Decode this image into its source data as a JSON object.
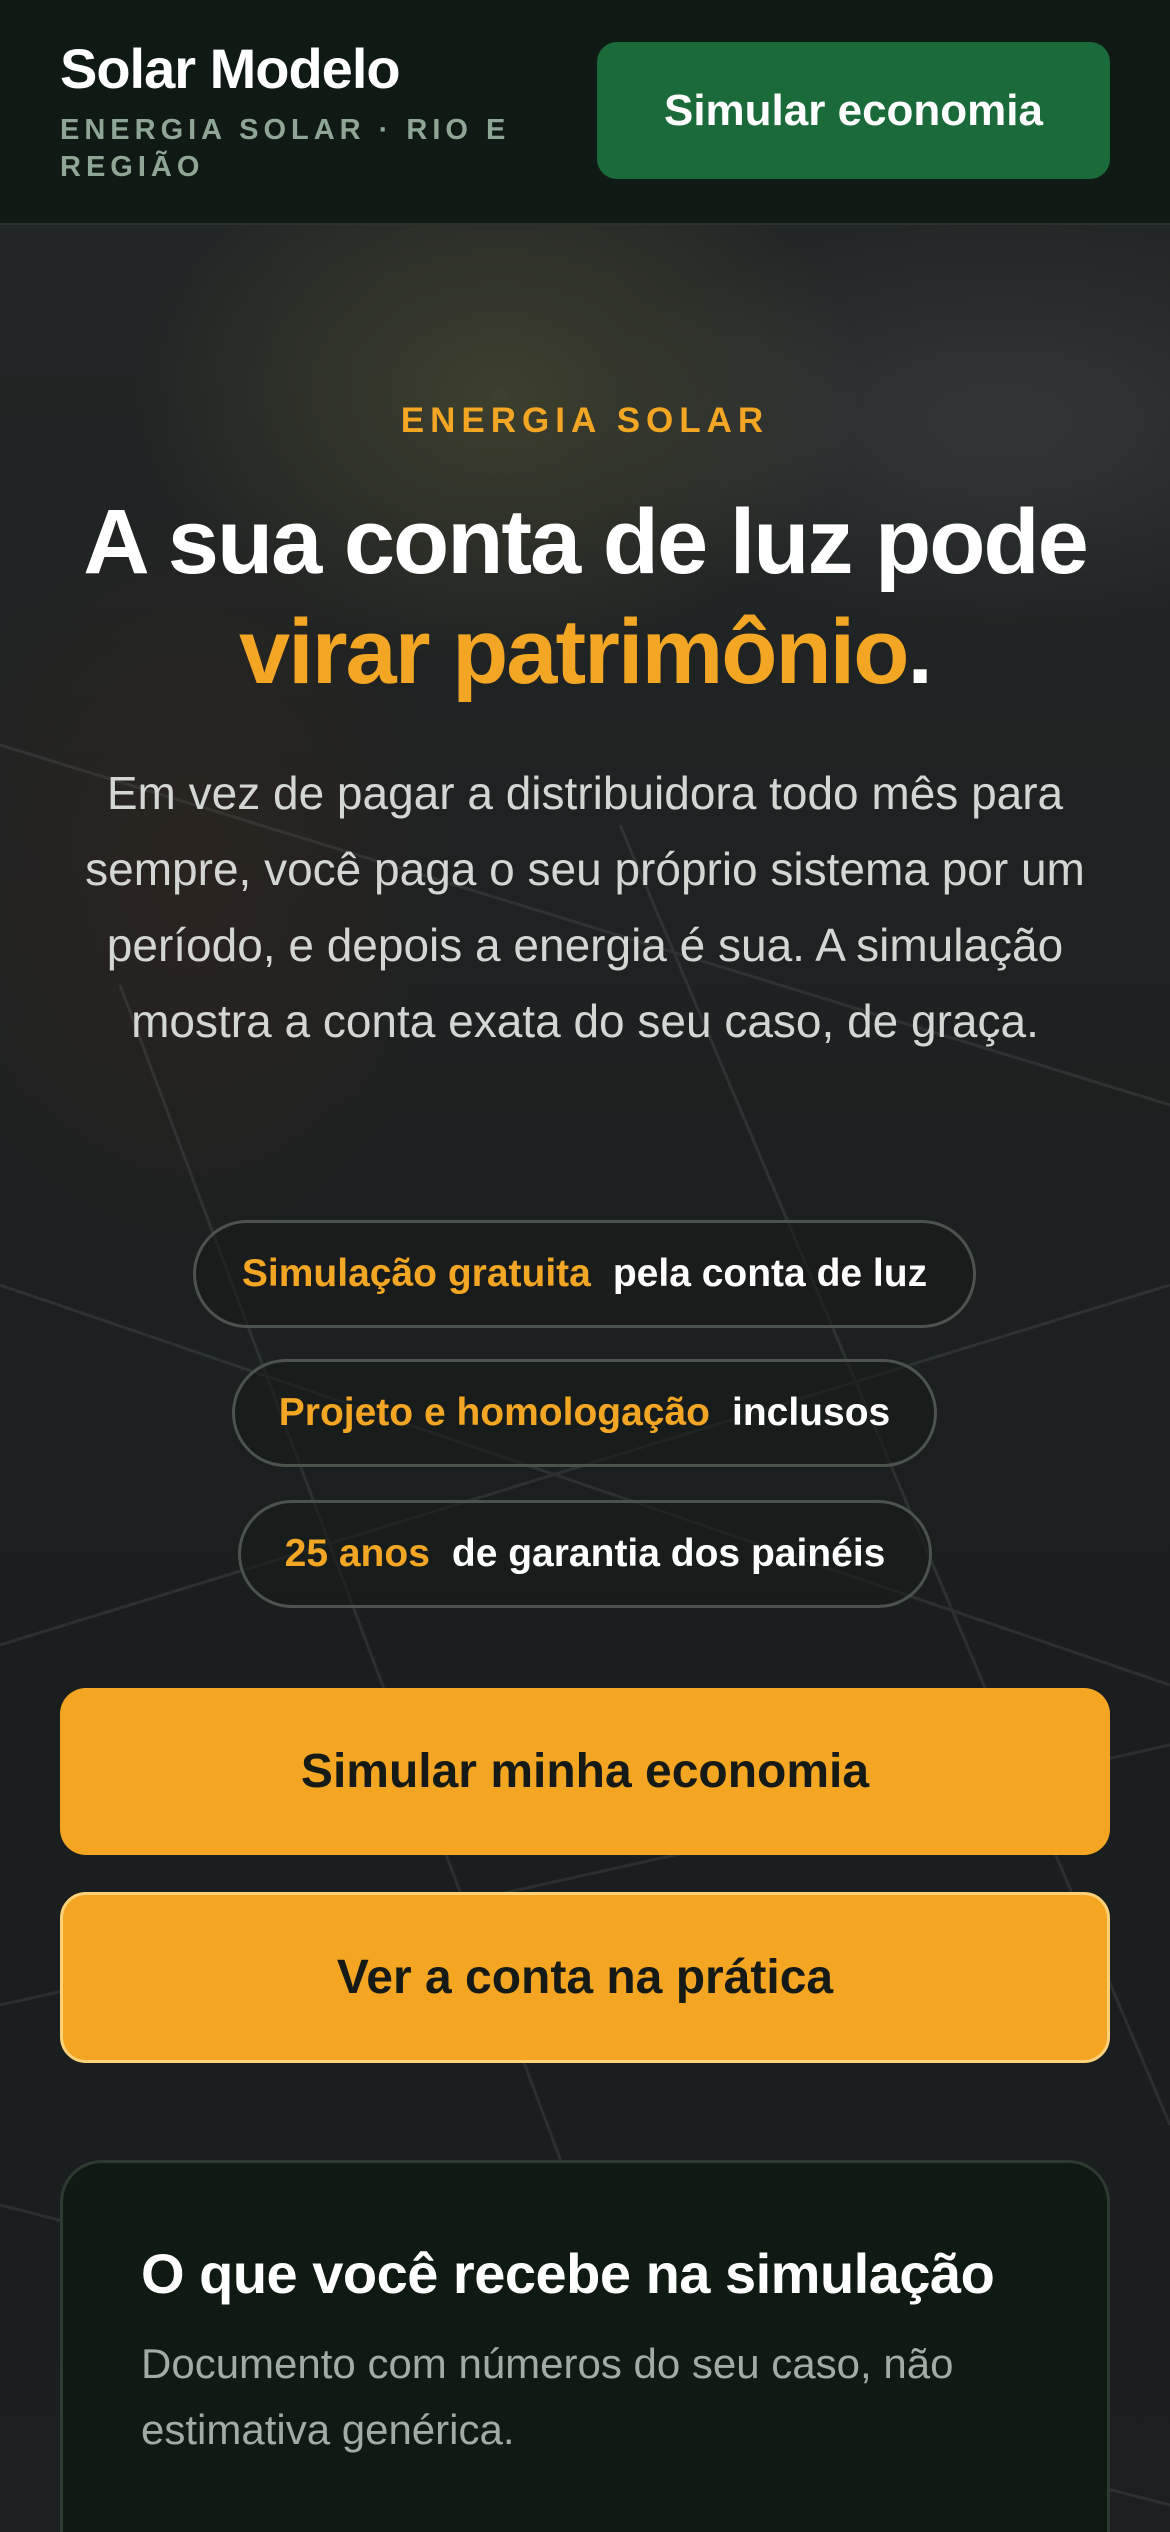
{
  "header": {
    "brand_name": "Solar Modelo",
    "brand_tagline": "ENERGIA SOLAR · RIO E REGIÃO",
    "cta_label": "Simular economia"
  },
  "hero": {
    "eyebrow": "ENERGIA SOLAR",
    "headline_part1": "A sua conta de luz pode",
    "headline_accent": "virar patrimônio",
    "headline_end": ".",
    "lead": "Em vez de pagar a distribuidora todo mês para sempre, você paga o seu próprio sistema por um período, e depois a energia é sua. A simulação mostra a conta exata do seu caso, de graça.",
    "pills": [
      {
        "strong": "Simulação gratuita",
        "text": "pela conta de luz"
      },
      {
        "strong": "Projeto e homologação",
        "text": "inclusos"
      },
      {
        "strong": "25 anos",
        "text": "de garantia dos painéis"
      }
    ],
    "primary_cta": "Simular minha economia",
    "secondary_cta": "Ver a conta na prática"
  },
  "card": {
    "title": "O que você recebe na simulação",
    "text": "Documento com números do seu caso, não estimativa genérica."
  },
  "colors": {
    "accent": "#f2a623",
    "brand_green": "#1b6b3a",
    "header_bg": "#101a14",
    "card_bg": "#0f1a13"
  }
}
